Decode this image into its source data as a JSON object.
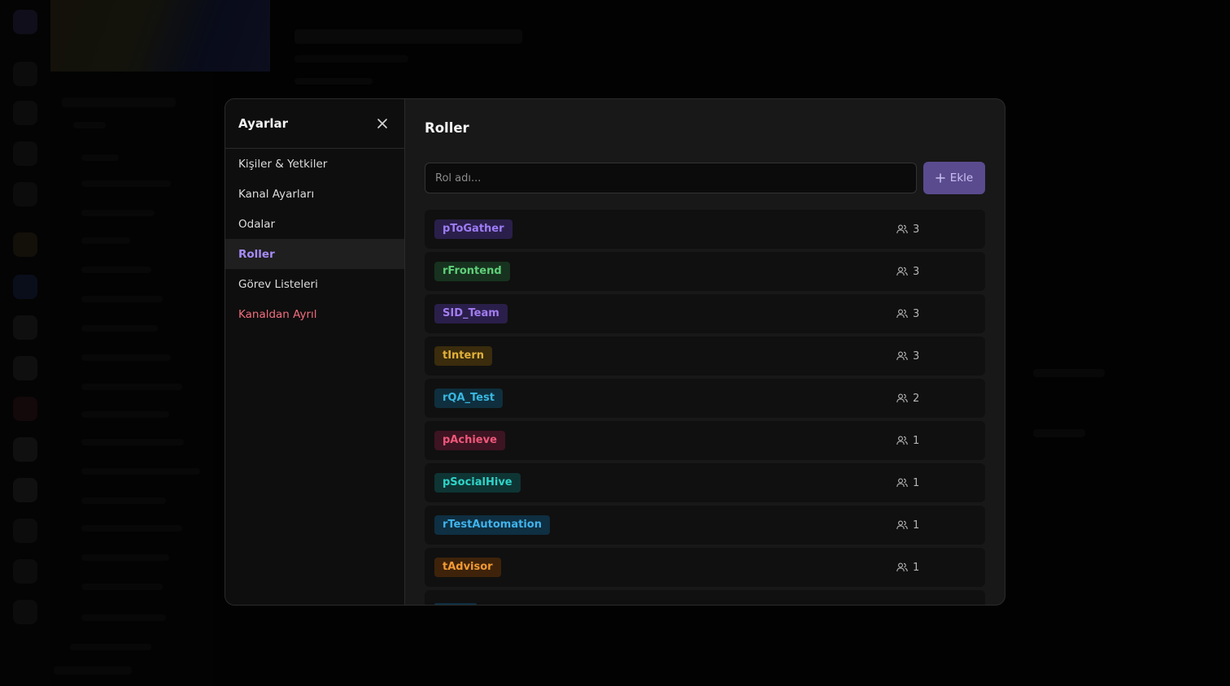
{
  "modal": {
    "sidebar": {
      "title": "Ayarlar",
      "items": [
        {
          "label": "Kişiler & Yetkiler",
          "name": "sidebar-item-people-permissions"
        },
        {
          "label": "Kanal Ayarları",
          "name": "sidebar-item-channel-settings"
        },
        {
          "label": "Odalar",
          "name": "sidebar-item-rooms"
        },
        {
          "label": "Roller",
          "name": "sidebar-item-roles",
          "active": true
        },
        {
          "label": "Görev Listeleri",
          "name": "sidebar-item-task-lists"
        },
        {
          "label": "Kanaldan Ayrıl",
          "name": "sidebar-item-leave-channel",
          "danger": true
        }
      ]
    },
    "main": {
      "title": "Roller",
      "input_placeholder": "Rol adı...",
      "add_label": "Ekle",
      "roles": [
        {
          "name": "pToGather",
          "count": "3",
          "color": "#9d7cf5",
          "bg": "#2a1f4a"
        },
        {
          "name": "rFrontend",
          "count": "3",
          "color": "#5fcf78",
          "bg": "#17321f"
        },
        {
          "name": "SID_Team",
          "count": "3",
          "color": "#a37cf2",
          "bg": "#2a1f4a"
        },
        {
          "name": "tIntern",
          "count": "3",
          "color": "#e2b03a",
          "bg": "#3a2c0c"
        },
        {
          "name": "rQA_Test",
          "count": "2",
          "color": "#38b7e0",
          "bg": "#0f2f3e"
        },
        {
          "name": "pAchieve",
          "count": "1",
          "color": "#f0577a",
          "bg": "#3d1422"
        },
        {
          "name": "pSocialHive",
          "count": "1",
          "color": "#2fd3c8",
          "bg": "#0e3534"
        },
        {
          "name": "rTestAutomation",
          "count": "1",
          "color": "#3fb3ec",
          "bg": "#0f2f42"
        },
        {
          "name": "tAdvisor",
          "count": "1",
          "color": "#f29a33",
          "bg": "#3e230a"
        }
      ],
      "partial_role_bg": "#0f2f42"
    }
  },
  "colors": {
    "accent": "#a78bfa",
    "danger": "#f26d7d",
    "button_bg": "#5a4b8f"
  }
}
